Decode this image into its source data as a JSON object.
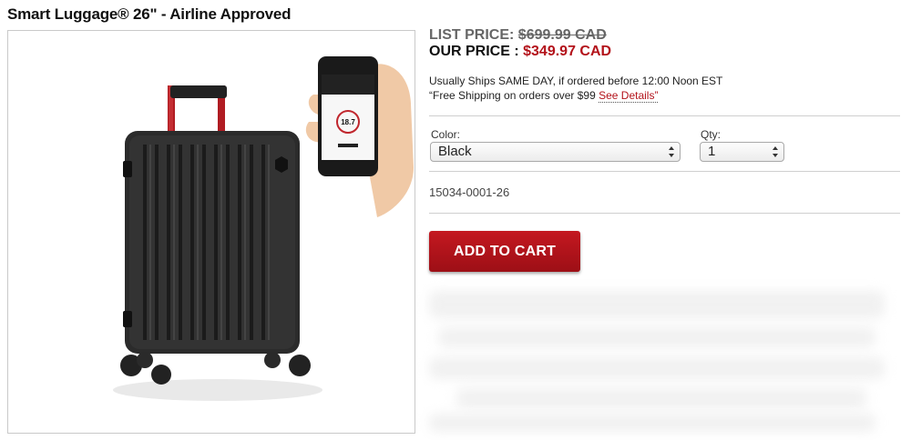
{
  "product": {
    "title": "Smart Luggage® 26\" - Airline Approved",
    "sku": "15034-0001-26"
  },
  "pricing": {
    "list_label": "LIST PRICE:",
    "list_value": "$699.99 CAD",
    "our_label": "OUR PRICE :",
    "our_value": "$349.97 CAD"
  },
  "shipping": {
    "line1": "Usually Ships SAME DAY, if ordered before 12:00 Noon EST",
    "line2_prefix": "“Free Shipping on orders over $99 ",
    "see_details": "See Details”"
  },
  "options": {
    "color_label": "Color:",
    "color_value": "Black",
    "qty_label": "Qty:",
    "qty_value": "1"
  },
  "actions": {
    "add_to_cart": "ADD TO CART"
  },
  "phone_screen": {
    "reading": "18.7"
  },
  "colors": {
    "accent_red": "#b3121a",
    "button_red": "#a8121a"
  }
}
